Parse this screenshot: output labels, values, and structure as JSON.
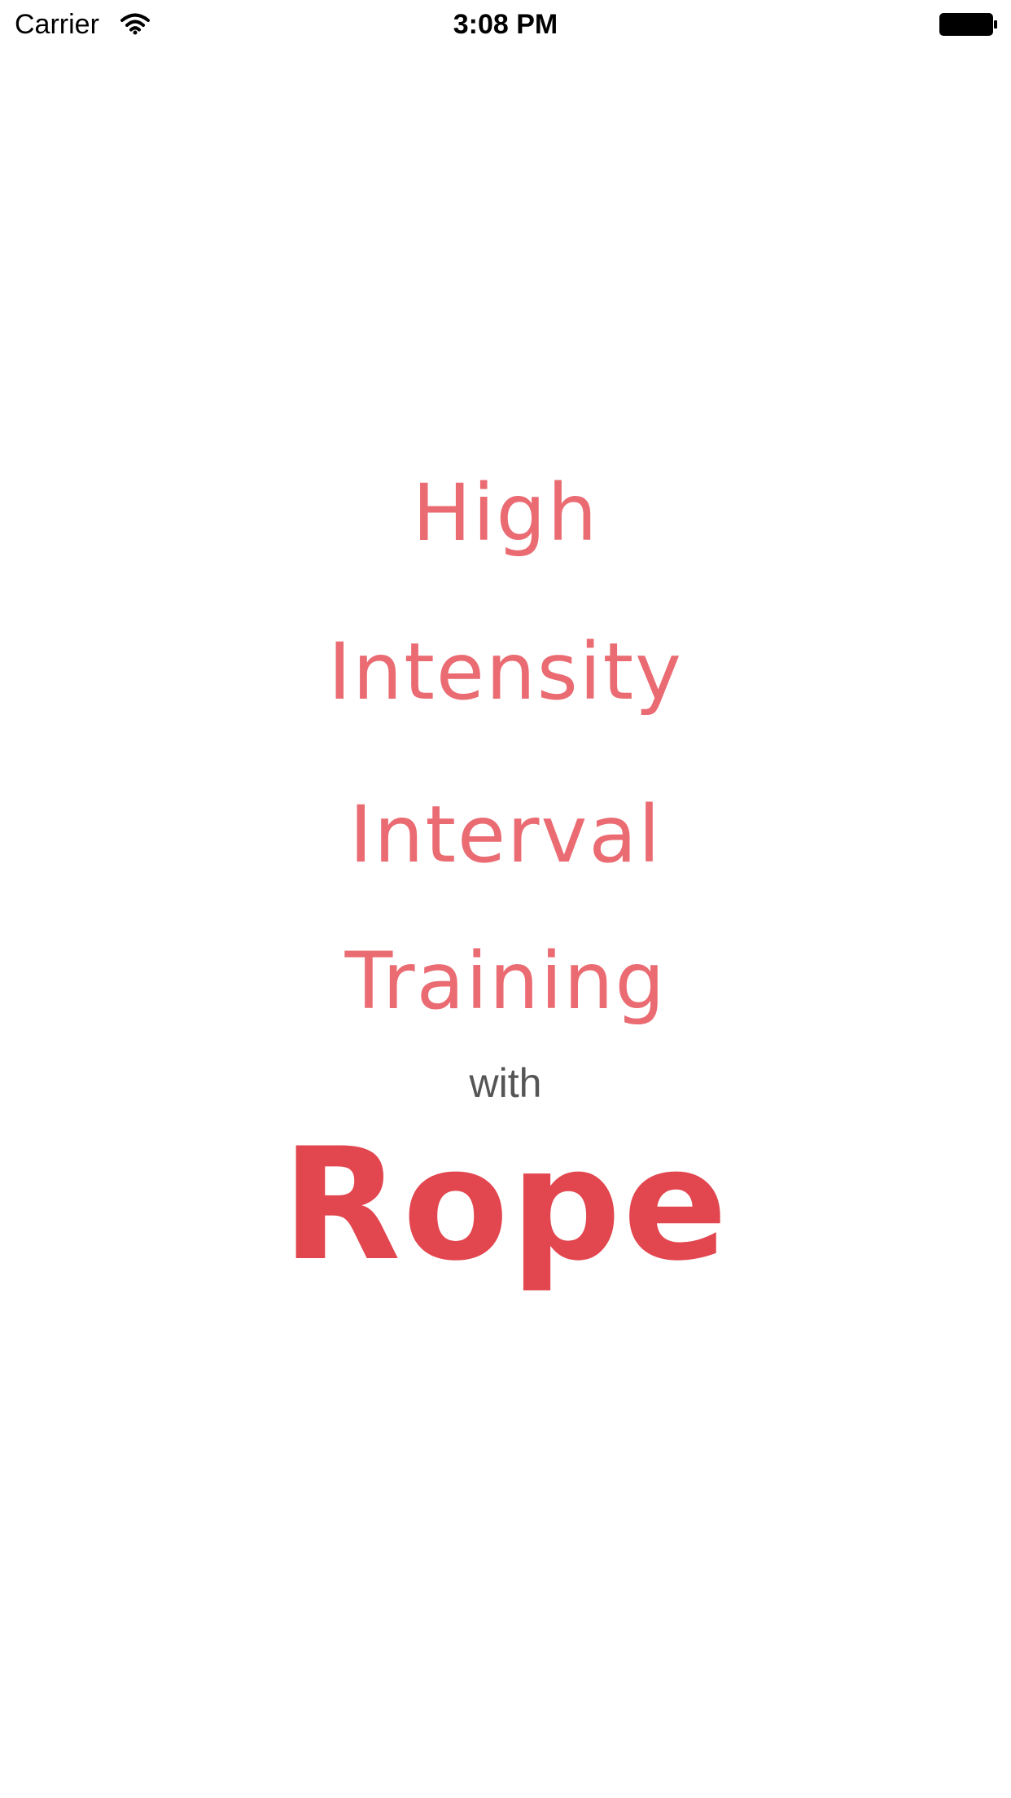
{
  "status_bar": {
    "carrier": "Carrier",
    "time": "3:08 PM",
    "wifi_icon": "wifi-icon",
    "battery_icon": "battery-full-icon"
  },
  "splash": {
    "lines": [
      "High",
      "Intensity",
      "Interval",
      "Training"
    ],
    "connector": "with",
    "subject": "Rope"
  },
  "colors": {
    "title": "#ea6b72",
    "subject": "#e2464f",
    "connector": "#555555",
    "background": "#ffffff"
  }
}
